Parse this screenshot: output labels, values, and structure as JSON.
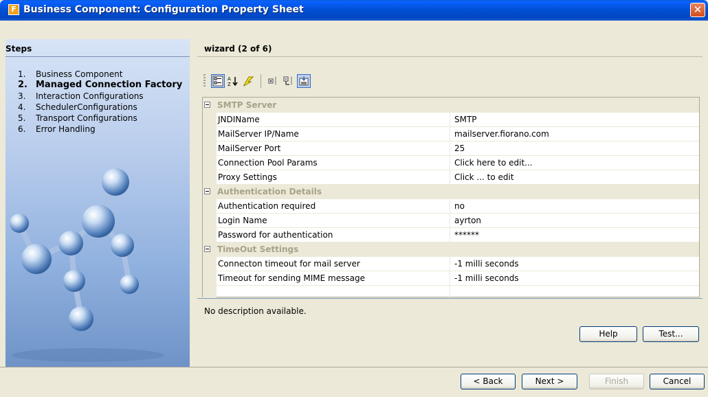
{
  "window": {
    "title": "Business Component: Configuration Property Sheet",
    "close": "✕"
  },
  "steps": {
    "heading": "Steps",
    "items": [
      {
        "num": "1.",
        "label": "Business Component"
      },
      {
        "num": "2.",
        "label": "Managed Connection Factory"
      },
      {
        "num": "3.",
        "label": "Interaction Configurations"
      },
      {
        "num": "4.",
        "label": "SchedulerConfigurations"
      },
      {
        "num": "5.",
        "label": "Transport Configurations"
      },
      {
        "num": "6.",
        "label": "Error Handling"
      }
    ]
  },
  "pane": {
    "title": "wizard (2 of 6)"
  },
  "toolbar": {
    "icons": [
      "categorized-view-icon",
      "sort-alphabetical-icon",
      "expert-mode-icon",
      "expand-all-icon",
      "collapse-all-icon",
      "show-description-icon"
    ]
  },
  "sheet": {
    "groups": [
      {
        "title": "SMTP Server",
        "rows": [
          {
            "name": "JNDIName",
            "value": "SMTP"
          },
          {
            "name": "MailServer IP/Name",
            "value": "mailserver.fiorano.com"
          },
          {
            "name": "MailServer Port",
            "value": "25"
          },
          {
            "name": "Connection Pool Params",
            "value": "Click here to edit..."
          },
          {
            "name": "Proxy Settings",
            "value": "Click ... to edit"
          }
        ]
      },
      {
        "title": "Authentication Details",
        "rows": [
          {
            "name": "Authentication required",
            "value": "no"
          },
          {
            "name": "Login Name",
            "value": "ayrton"
          },
          {
            "name": "Password for authentication",
            "value": "******"
          }
        ]
      },
      {
        "title": "TimeOut Settings",
        "rows": [
          {
            "name": "Connecton timeout for mail server",
            "value": "-1  milli seconds"
          },
          {
            "name": "Timeout for sending MIME message",
            "value": "-1  milli seconds"
          }
        ]
      }
    ]
  },
  "description": "No description available.",
  "buttons": {
    "help": "Help",
    "test": "Test...",
    "back": "< Back",
    "next": "Next >",
    "finish": "Finish",
    "cancel": "Cancel"
  },
  "colors": {
    "titlebar": "#0150d6",
    "accent": "#316ac5",
    "group_header_text": "#a8a28a"
  }
}
